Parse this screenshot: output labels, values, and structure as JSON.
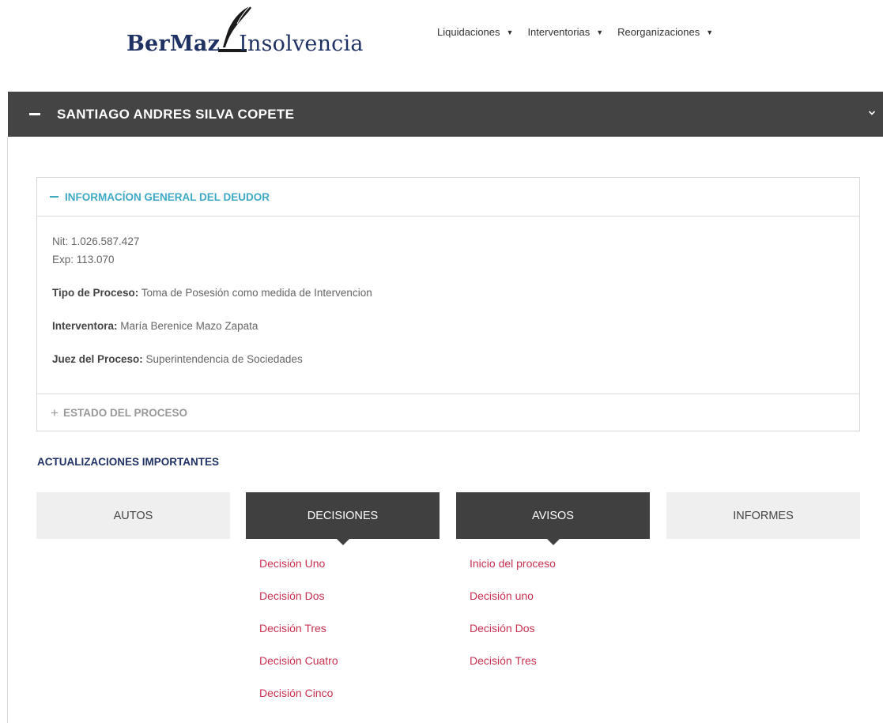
{
  "logo": {
    "brand": "BerMaz",
    "rest": "Insolvencia"
  },
  "nav": [
    {
      "label": "Liquidaciones"
    },
    {
      "label": "Interventorias"
    },
    {
      "label": "Reorganizaciones"
    }
  ],
  "accordion": {
    "title": "SANTIAGO ANDRES SILVA COPETE"
  },
  "info_panel": {
    "title": "INFORMACÍON GENERAL DEL DEUDOR",
    "nit": "Nit: 1.026.587.427",
    "exp": "Exp: 113.070",
    "tipo_label": "Tipo de Proceso:",
    "tipo_value": " Toma de Posesión como medida de Intervencion",
    "interventora_label": "Interventora:",
    "interventora_value": " María Berenice Mazo Zapata",
    "juez_label": "Juez del Proceso:",
    "juez_value": " Superintendencia de Sociedades",
    "estado_title": "ESTADO DEL PROCESO"
  },
  "updates_title": "ACTUALIZACIONES IMPORTANTES",
  "tabs": [
    {
      "label": "AUTOS"
    },
    {
      "label": "DECISIONES"
    },
    {
      "label": "AVISOS"
    },
    {
      "label": "INFORMES"
    }
  ],
  "decisiones_links": [
    "Decisión Uno",
    "Decisión Dos",
    "Decisión Tres",
    "Decisión Cuatro",
    "Decisión Cinco"
  ],
  "avisos_links": [
    "Inicio del proceso",
    "Decisión uno",
    "Decisión Dos",
    "Decisión Tres"
  ],
  "colors": {
    "accent": "#3fa9c5",
    "brand": "#1f3263",
    "link": "#c7304f",
    "dark": "#404040"
  }
}
